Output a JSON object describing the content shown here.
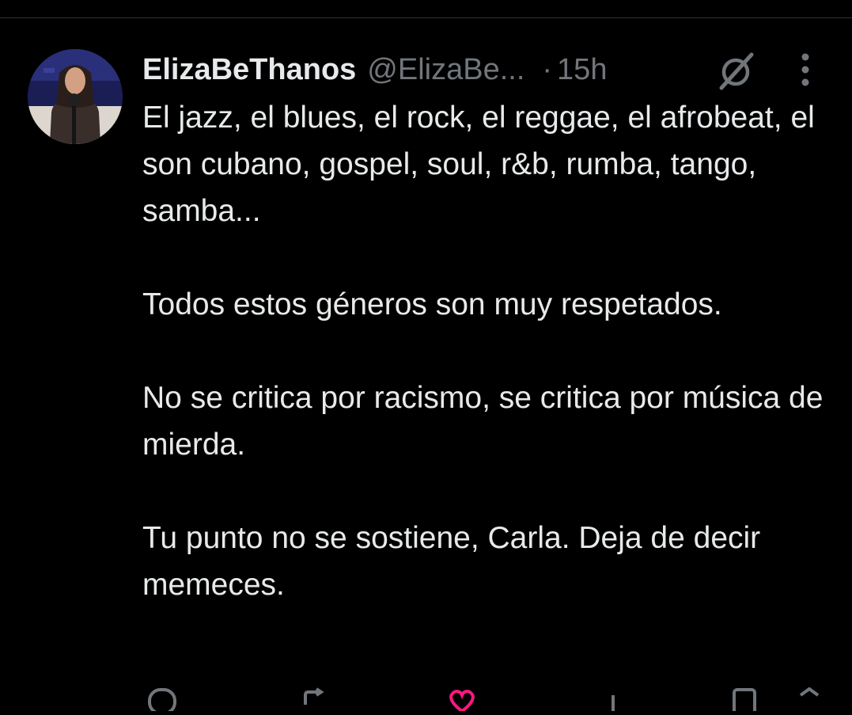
{
  "tweet": {
    "author": {
      "display_name": "ElizaBeThanos",
      "handle": "@ElizaBe...",
      "avatar_icon": "avatar-woman-with-microphone"
    },
    "separator": "·",
    "timestamp": "15h",
    "paragraphs": [
      "El jazz, el blues, el rock, el reggae, el afrobeat, el son cubano, gospel, soul, r&b, rumba, tango, samba...",
      "Todos estos géneros son muy respetados.",
      "No se critica por racismo, se critica por música de mierda.",
      "Tu punto no se sostiene, Carla. Deja de decir memeces."
    ]
  },
  "icons": {
    "grok": "grok-icon",
    "more": "more-icon",
    "reply": "reply-icon",
    "repost": "repost-icon",
    "like": "like-icon",
    "views": "views-icon",
    "bookmark": "bookmark-icon",
    "share": "share-icon"
  },
  "colors": {
    "background": "#000000",
    "text_primary": "#e7e9ea",
    "text_secondary": "#71767b",
    "divider": "#2f3336",
    "like_accent": "#f91880"
  }
}
